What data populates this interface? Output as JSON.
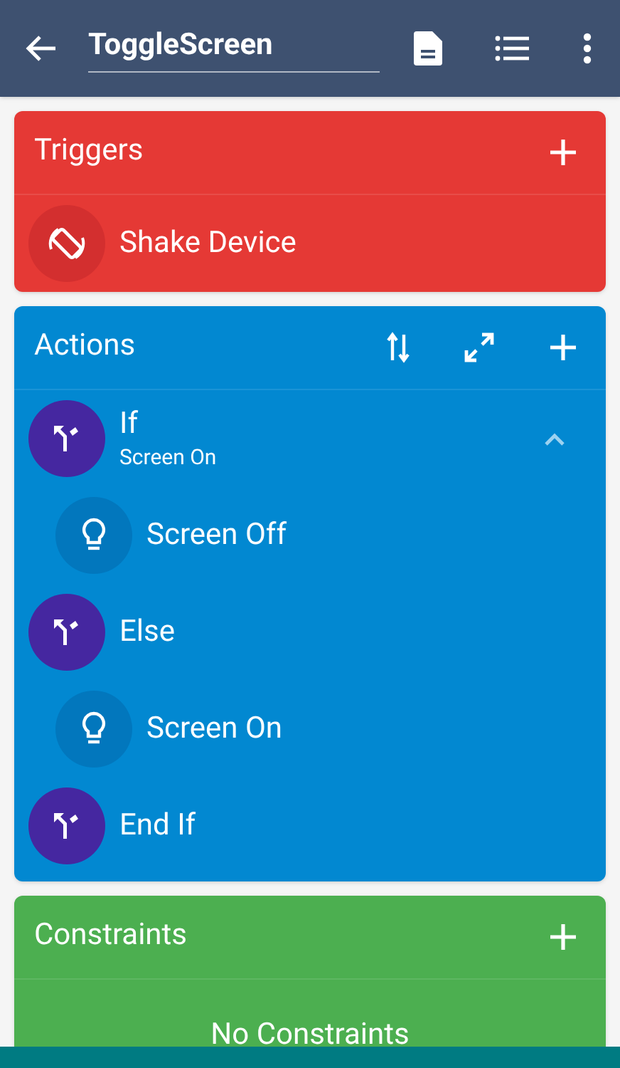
{
  "app_bar": {
    "macro_name": "ToggleScreen"
  },
  "triggers": {
    "title": "Triggers",
    "items": [
      {
        "kind": "trigger",
        "label": "Shake Device"
      }
    ]
  },
  "actions": {
    "title": "Actions",
    "items": [
      {
        "kind": "condition",
        "label": "If",
        "subtitle": "Screen On",
        "expanded": true,
        "children": [
          {
            "kind": "action",
            "label": "Screen Off"
          }
        ]
      },
      {
        "kind": "condition",
        "label": "Else",
        "children": [
          {
            "kind": "action",
            "label": "Screen On"
          }
        ]
      },
      {
        "kind": "condition",
        "label": "End If"
      }
    ]
  },
  "constraints": {
    "title": "Constraints",
    "empty_text": "No Constraints"
  }
}
